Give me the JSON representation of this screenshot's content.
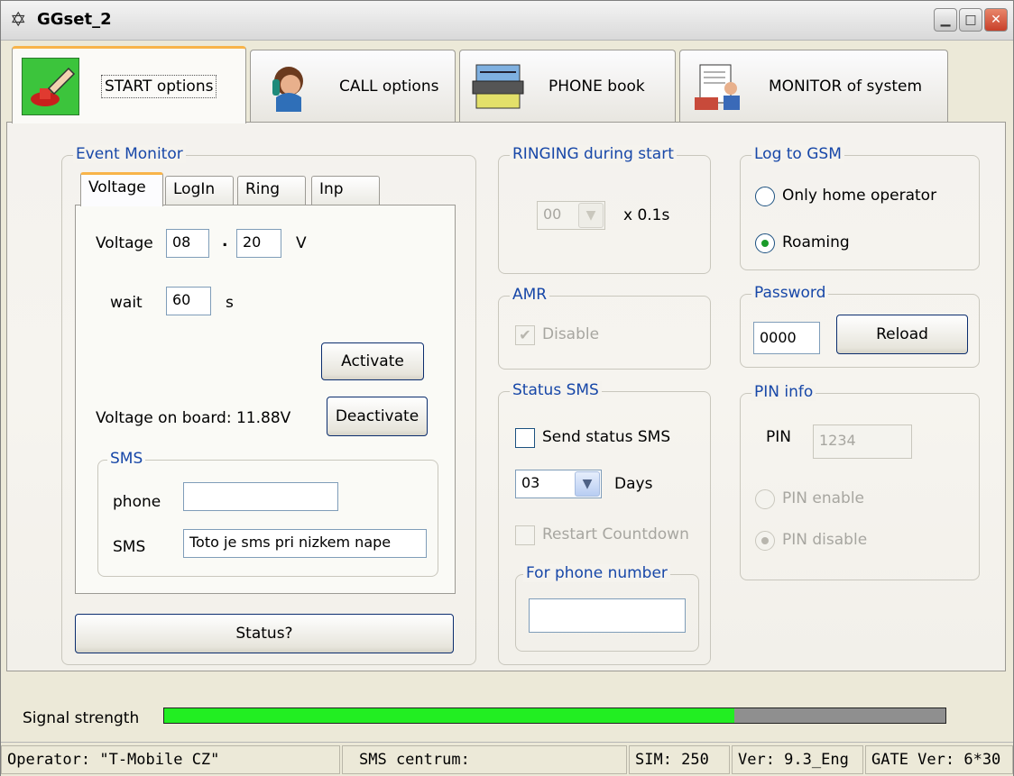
{
  "window": {
    "title": "GGset_2"
  },
  "tabs": [
    {
      "label": "START options"
    },
    {
      "label": "CALL options"
    },
    {
      "label": "PHONE book"
    },
    {
      "label": "MONITOR of system"
    }
  ],
  "event_monitor": {
    "title": "Event Monitor",
    "subtabs": [
      "Voltage",
      "LogIn",
      "Ring",
      "Inp"
    ],
    "voltage_label": "Voltage",
    "voltage_int": "08",
    "voltage_sep": ".",
    "voltage_dec": "20",
    "voltage_unit": "V",
    "wait_label": "wait",
    "wait_value": "60",
    "wait_unit": "s",
    "activate": "Activate",
    "deactivate": "Deactivate",
    "voltage_on_board": "Voltage on board: 11.88V",
    "sms": {
      "title": "SMS",
      "phone_label": "phone",
      "phone_value": "",
      "sms_label": "SMS",
      "sms_value": "Toto je sms pri nizkem nape"
    },
    "status_button": "Status?"
  },
  "ringing": {
    "title": "RINGING during start",
    "value": "00",
    "unit": "x 0.1s"
  },
  "amr": {
    "title": "AMR",
    "disable_label": "Disable",
    "disable_checked": true
  },
  "status_sms": {
    "title": "Status SMS",
    "send_label": "Send status SMS",
    "days_value": "03",
    "days_label": "Days",
    "restart_label": "Restart Countdown",
    "for_phone_title": "For phone number",
    "for_phone_value": ""
  },
  "log_to_gsm": {
    "title": "Log to GSM",
    "only_home": "Only home operator",
    "roaming": "Roaming",
    "selected": "roaming"
  },
  "password": {
    "title": "Password",
    "value": "0000",
    "reload": "Reload"
  },
  "pin_info": {
    "title": "PIN info",
    "pin_label": "PIN",
    "pin_value": "1234",
    "enable": "PIN enable",
    "disable": "PIN disable",
    "selected": "disable"
  },
  "signal": {
    "label": "Signal strength",
    "level": 0.73,
    "fill_color": "#22ee22",
    "track_color": "#8f8f8f"
  },
  "statusbar": {
    "operator": "Operator: \"T-Mobile CZ\"",
    "sms_centrum": "SMS centrum:",
    "sim": "SIM: 250",
    "ver": "Ver: 9.3_Eng",
    "gate_ver": "GATE Ver: 6*30"
  }
}
